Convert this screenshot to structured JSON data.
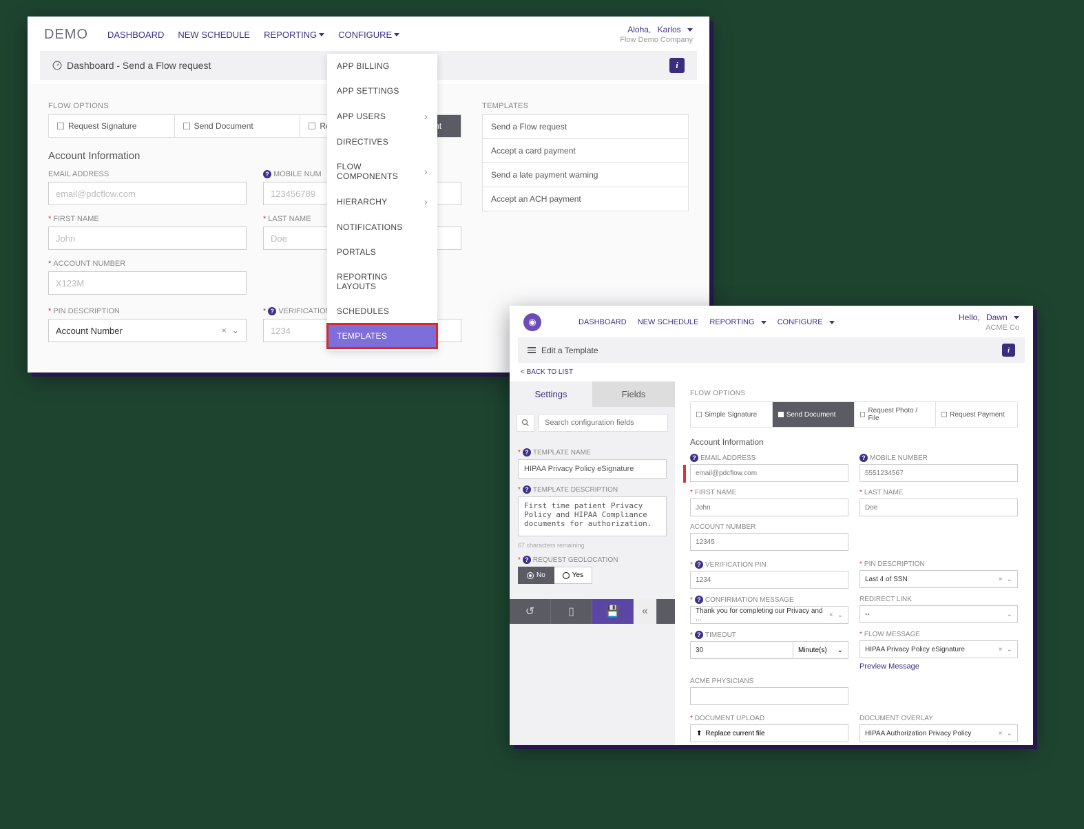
{
  "w1": {
    "logo": "DEMO",
    "nav": [
      "DASHBOARD",
      "NEW SCHEDULE",
      "REPORTING",
      "CONFIGURE"
    ],
    "user_prefix": "Aloha,",
    "user_name": "Karlos",
    "company": "Flow Demo Company",
    "page_title": "Dashboard - Send a Flow request",
    "flow_options_label": "FLOW OPTIONS",
    "flow_opts": [
      "Request Signature",
      "Send Document",
      "Request Pict",
      "nt"
    ],
    "acct_info": "Account Information",
    "email_label": "EMAIL ADDRESS",
    "email_ph": "email@pdcflow.com",
    "mobile_label": "MOBILE NUM",
    "mobile_ph": "123456789",
    "first_label": "FIRST NAME",
    "first_ph": "John",
    "last_label": "LAST NAME",
    "last_ph": "Doe",
    "acct_label": "ACCOUNT NUMBER",
    "acct_ph": "X123M",
    "pin_desc_label": "PIN DESCRIPTION",
    "pin_desc_val": "Account Number",
    "vpin_label": "VERIFICATION PIN",
    "vpin_ph": "1234",
    "config_menu": [
      "APP BILLING",
      "APP SETTINGS",
      "APP USERS",
      "DIRECTIVES",
      "FLOW COMPONENTS",
      "HIERARCHY",
      "NOTIFICATIONS",
      "PORTALS",
      "REPORTING LAYOUTS",
      "SCHEDULES",
      "TEMPLATES"
    ],
    "templates_label": "TEMPLATES",
    "templates": [
      "Send a Flow request",
      "Accept a card payment",
      "Send a late payment warning",
      "Accept an ACH payment"
    ]
  },
  "w2": {
    "nav": [
      "DASHBOARD",
      "NEW SCHEDULE",
      "REPORTING",
      "CONFIGURE"
    ],
    "user_prefix": "Hello,",
    "user_name": "Dawn",
    "company": "ACME Co",
    "page_title": "Edit a Template",
    "back": "< BACK TO LIST",
    "tabs": [
      "Settings",
      "Fields"
    ],
    "search_ph": "Search configuration fields",
    "tname_label": "TEMPLATE NAME",
    "tname_val": "HIPAA Privacy Policy eSignature",
    "tdesc_label": "TEMPLATE DESCRIPTION",
    "tdesc_val": "First time patient Privacy Policy and HIPAA Compliance documents for authorization.",
    "tdesc_chars": "67 characters remaining",
    "geo_label": "REQUEST GEOLOCATION",
    "geo_no": "No",
    "geo_yes": "Yes",
    "flow_options_label": "FLOW OPTIONS",
    "flow_opts": [
      "Simple Signature",
      "Send Document",
      "Request Photo / File",
      "Request Payment"
    ],
    "acct_info": "Account Information",
    "email_label": "EMAIL ADDRESS",
    "email_ph": "email@pdcflow.com",
    "mobile_label": "MOBILE NUMBER",
    "mobile_ph": "5551234567",
    "first_label": "FIRST NAME",
    "first_ph": "John",
    "last_label": "LAST NAME",
    "last_ph": "Doe",
    "acct_label": "ACCOUNT NUMBER",
    "acct_ph": "12345",
    "vpin_label": "VERIFICATION PIN",
    "vpin_ph": "1234",
    "pin_desc_label": "PIN DESCRIPTION",
    "pin_desc_val": "Last 4 of SSN",
    "conf_label": "CONFIRMATION MESSAGE",
    "conf_val": "Thank you for completing our Privacy and ...",
    "redir_label": "REDIRECT LINK",
    "redir_val": "--",
    "timeout_label": "TIMEOUT",
    "timeout_val": "30",
    "timeout_unit": "Minute(s)",
    "fmsg_label": "FLOW MESSAGE",
    "fmsg_val": "HIPAA Privacy Policy eSignature",
    "preview": "Preview Message",
    "phys_label": "ACME PHYSICIANS",
    "doc_up_label": "DOCUMENT UPLOAD",
    "doc_up_btn": "Replace current file",
    "doc_ov_label": "DOCUMENT OVERLAY",
    "doc_ov_val": "HIPAA Authorization Privacy Policy"
  }
}
